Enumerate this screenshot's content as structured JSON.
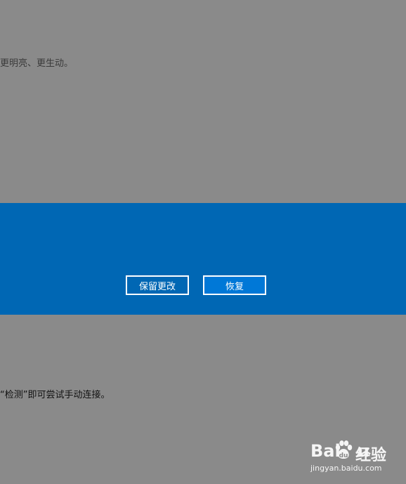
{
  "background": {
    "top_text": "更明亮、更生动。",
    "bottom_text": "“检测”即可尝试手动连接。"
  },
  "dialog": {
    "keep_label": "保留更改",
    "revert_label": "恢复"
  },
  "watermark": {
    "logo_left": "Bai",
    "logo_right": "u",
    "brand_cn": "经验",
    "url": "jingyan.baidu.com"
  },
  "colors": {
    "overlay_gray": "#8a8a8a",
    "dialog_blue": "#0067b4",
    "button_accent": "#0078d7"
  }
}
